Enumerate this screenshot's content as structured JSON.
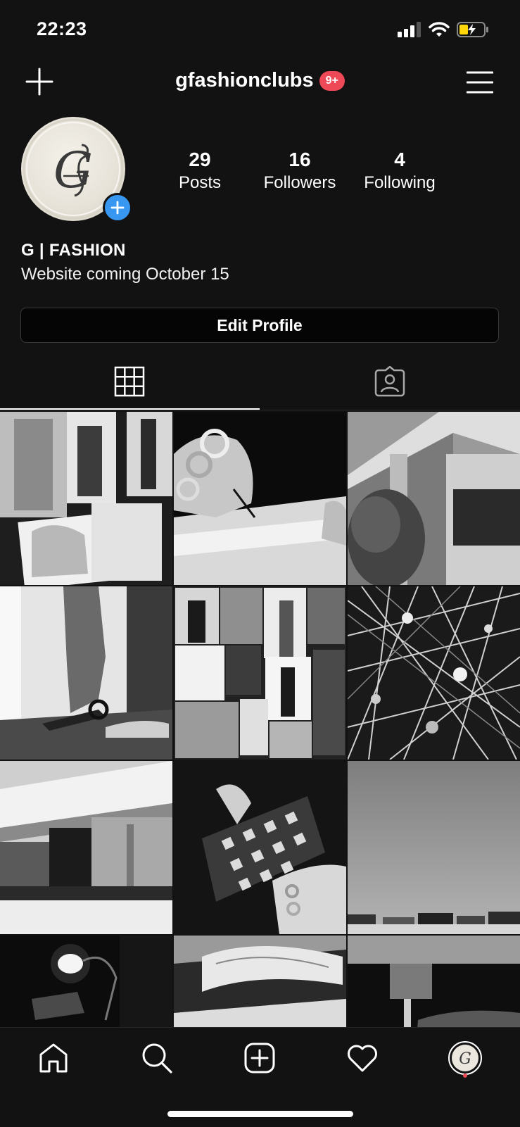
{
  "status_bar": {
    "time": "22:23",
    "icons": [
      "signal-icon",
      "wifi-icon",
      "battery-charging-icon"
    ]
  },
  "header": {
    "username": "gfashionclubs",
    "notification_badge": "9+",
    "left_icon": "plus-icon",
    "right_icon": "menu-icon"
  },
  "profile": {
    "avatar_monogram": "G",
    "stats": [
      {
        "value": "29",
        "label": "Posts"
      },
      {
        "value": "16",
        "label": "Followers"
      },
      {
        "value": "4",
        "label": "Following"
      }
    ],
    "name": "G | FASHION",
    "bio": "Website coming October 15",
    "edit_button": "Edit Profile"
  },
  "tabs": [
    {
      "icon": "grid-icon",
      "active": true
    },
    {
      "icon": "tagged-icon",
      "active": false
    }
  ],
  "posts": [
    {
      "subject": "knitwear-collage"
    },
    {
      "subject": "ringed-hand-sketching"
    },
    {
      "subject": "concrete-architecture-tree"
    },
    {
      "subject": "fabric-cutting-scissors"
    },
    {
      "subject": "fashion-moodboard"
    },
    {
      "subject": "sewing-pins"
    },
    {
      "subject": "modern-house-terrace"
    },
    {
      "subject": "sequin-fabric-hands"
    },
    {
      "subject": "grey-wall-books"
    },
    {
      "subject": "desk-lamp"
    },
    {
      "subject": "open-sketchbook"
    },
    {
      "subject": "sewing-machine"
    }
  ],
  "bottom_nav": [
    "home-icon",
    "search-icon",
    "new-post-icon",
    "activity-heart-icon",
    "profile-avatar"
  ],
  "colors": {
    "background": "#121212",
    "badge": "#ed4956",
    "add_story": "#3897f0"
  }
}
